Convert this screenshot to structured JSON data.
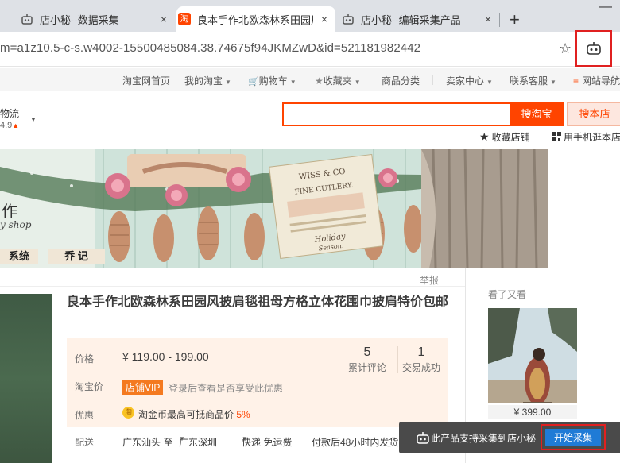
{
  "browser": {
    "tabs": [
      {
        "label": "店小秘--数据采集",
        "close": "×"
      },
      {
        "label": "良本手作北欧森林系田园风",
        "close": "×",
        "icon_text": "淘"
      },
      {
        "label": "店小秘--编辑采集产品",
        "close": "×"
      }
    ],
    "new_tab": "+",
    "minimize": "—",
    "url": "m=a1z10.5-c-s.w4002-15500485084.38.74675f94JKMZwD&id=521181982442",
    "bookmark_star": "☆"
  },
  "site_nav": {
    "items": [
      {
        "label": "淘宝网首页"
      },
      {
        "label": "我的淘宝",
        "caret": "▼"
      },
      {
        "label": "购物车",
        "caret": "▼"
      },
      {
        "label": "收藏夹",
        "caret": "▼"
      },
      {
        "label": "商品分类"
      },
      {
        "label": "卖家中心",
        "caret": "▼"
      },
      {
        "label": "联系客服",
        "caret": "▼"
      },
      {
        "label": "网站导航"
      }
    ],
    "cart_icon": "🛒",
    "star_icon": "★",
    "menu_icon": "≡"
  },
  "shop_header": {
    "wuliu": "物流",
    "score": "4.9",
    "score_up": "▲",
    "score_caret": "▼",
    "search_button": "搜淘宝",
    "search_shop_button": "搜本店",
    "fav_icon": "★",
    "fav_shop": "收藏店铺",
    "mobile_shop": "用手机逛本店"
  },
  "banner": {
    "word1": "作",
    "word2": "y shop",
    "tab1": "系统",
    "tab2": "乔 记",
    "card_line1": "WISS & CO",
    "card_line2": "FINE CUTLERY.",
    "card_line3": "Holiday",
    "card_line4": "Season."
  },
  "report": "举报",
  "product": {
    "title": "良本手作北欧森林系田园风披肩毯祖母方格立体花围巾披肩特价包邮",
    "price_label": "价格",
    "orig_price": "¥ 119.00 - 199.00",
    "reviews_count": "5",
    "reviews_label": "累计评论",
    "sales_count": "1",
    "sales_label": "交易成功",
    "tb_price_label": "淘宝价",
    "vip_badge": "店铺VIP",
    "vip_desc": "登录后查看是否享受此优惠",
    "promo_label": "优惠",
    "coin_icon": "淘",
    "coin_desc": "淘金币最高可抵商品价",
    "coin_pct": "5%",
    "ship_label": "配送",
    "ship_from": "广东汕头 至",
    "ship_to": "广东深圳",
    "ship_method": "快递 免运费",
    "ship_time": "付款后48小时内发货"
  },
  "right_rail": {
    "seen_title": "看了又看",
    "seen_price": "¥ 399.00"
  },
  "collect_bar": {
    "text": "此产品支持采集到店小秘",
    "button": "开始采集"
  },
  "colors": {
    "taobao_orange": "#ff4400",
    "highlight_red": "#e02020",
    "collect_blue": "#1f7bd6"
  }
}
